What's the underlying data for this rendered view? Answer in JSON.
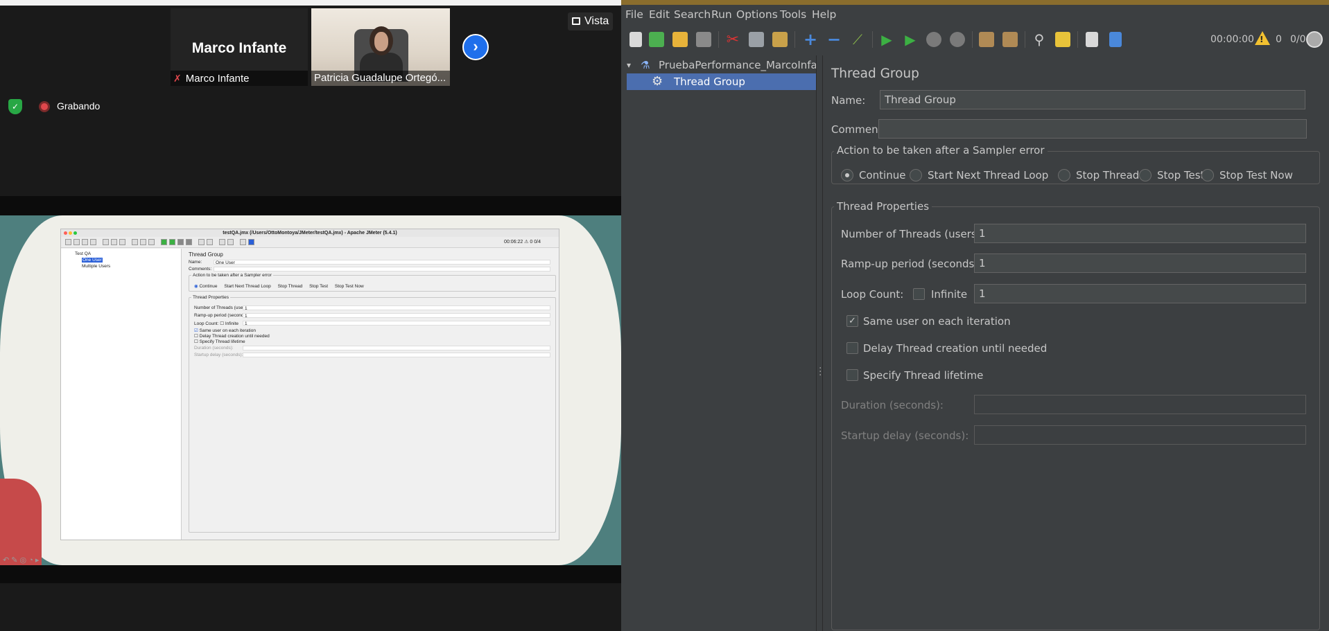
{
  "zoom": {
    "participant_name_big": "Marco Infante",
    "participant_label_1": "Marco Infante",
    "participant_label_2": "Patricia Guadalupe Ortegó...",
    "vista_label": "Vista",
    "recording_label": "Grabando"
  },
  "shared_screen": {
    "window_title": "testQA.jmx (/Users/OttoMontoya/JMeter/testQA.jmx) - Apache JMeter (5.4.1)",
    "timer": "00:06:22",
    "warn_count": "0",
    "threads": "0/4",
    "tree": [
      "Test QA",
      "One User",
      "Multiple Users"
    ],
    "heading": "Thread Group",
    "name_label": "Name:",
    "name_value": "One User",
    "comments_label": "Comments:",
    "action_legend": "Action to be taken after a Sampler error",
    "actions": [
      "Continue",
      "Start Next Thread Loop",
      "Stop Thread",
      "Stop Test",
      "Stop Test Now"
    ],
    "props_legend": "Thread Properties",
    "threads_label": "Number of Threads (users):",
    "threads_value": "1",
    "rampup_label": "Ramp-up period (seconds):",
    "rampup_value": "1",
    "loop_label": "Loop Count:",
    "infinite_label": "Infinite",
    "loop_value": "1",
    "same_user": "Same user on each iteration",
    "delay": "Delay Thread creation until needed",
    "lifetime": "Specify Thread lifetime",
    "duration": "Duration (seconds):",
    "startup": "Startup delay (seconds):"
  },
  "jmeter": {
    "menu": [
      "File",
      "Edit",
      "Search",
      "Run",
      "Options",
      "Tools",
      "Help"
    ],
    "timer": "00:00:00",
    "error_count": "0",
    "threads": "0/0",
    "tree": {
      "root": "PruebaPerformance_MarcoInfante.jmx",
      "selected": "Thread Group"
    },
    "form": {
      "heading": "Thread Group",
      "name_label": "Name:",
      "name_value": "Thread Group",
      "comments_label": "Comments:",
      "comments_value": "",
      "action_legend": "Action to be taken after a Sampler error",
      "actions": [
        "Continue",
        "Start Next Thread Loop",
        "Stop Thread",
        "Stop Test",
        "Stop Test Now"
      ],
      "action_selected": "Continue",
      "props_legend": "Thread Properties",
      "threads_label": "Number of Threads (users):",
      "threads_value": "1",
      "rampup_label": "Ramp-up period (seconds):",
      "rampup_value": "1",
      "loop_label": "Loop Count:",
      "infinite_label": "Infinite",
      "infinite_checked": false,
      "loop_value": "1",
      "same_user_label": "Same user on each iteration",
      "same_user_checked": true,
      "delay_label": "Delay Thread creation until needed",
      "delay_checked": false,
      "lifetime_label": "Specify Thread lifetime",
      "lifetime_checked": false,
      "duration_label": "Duration (seconds):",
      "duration_value": "",
      "startup_label": "Startup delay (seconds):",
      "startup_value": ""
    }
  },
  "colors": {
    "zoom_bg": "#1a1a1a",
    "jmeter_bg": "#3c3f41",
    "selection": "#4b6eaf",
    "accent_bar": "#8a6d2d",
    "recording": "#e0474c"
  },
  "icons": [
    "shield-icon",
    "record-icon",
    "grid-icon",
    "next-arrow-icon",
    "mic-muted-icon",
    "warning-icon",
    "globe-icon",
    "gear-icon",
    "flask-icon"
  ]
}
